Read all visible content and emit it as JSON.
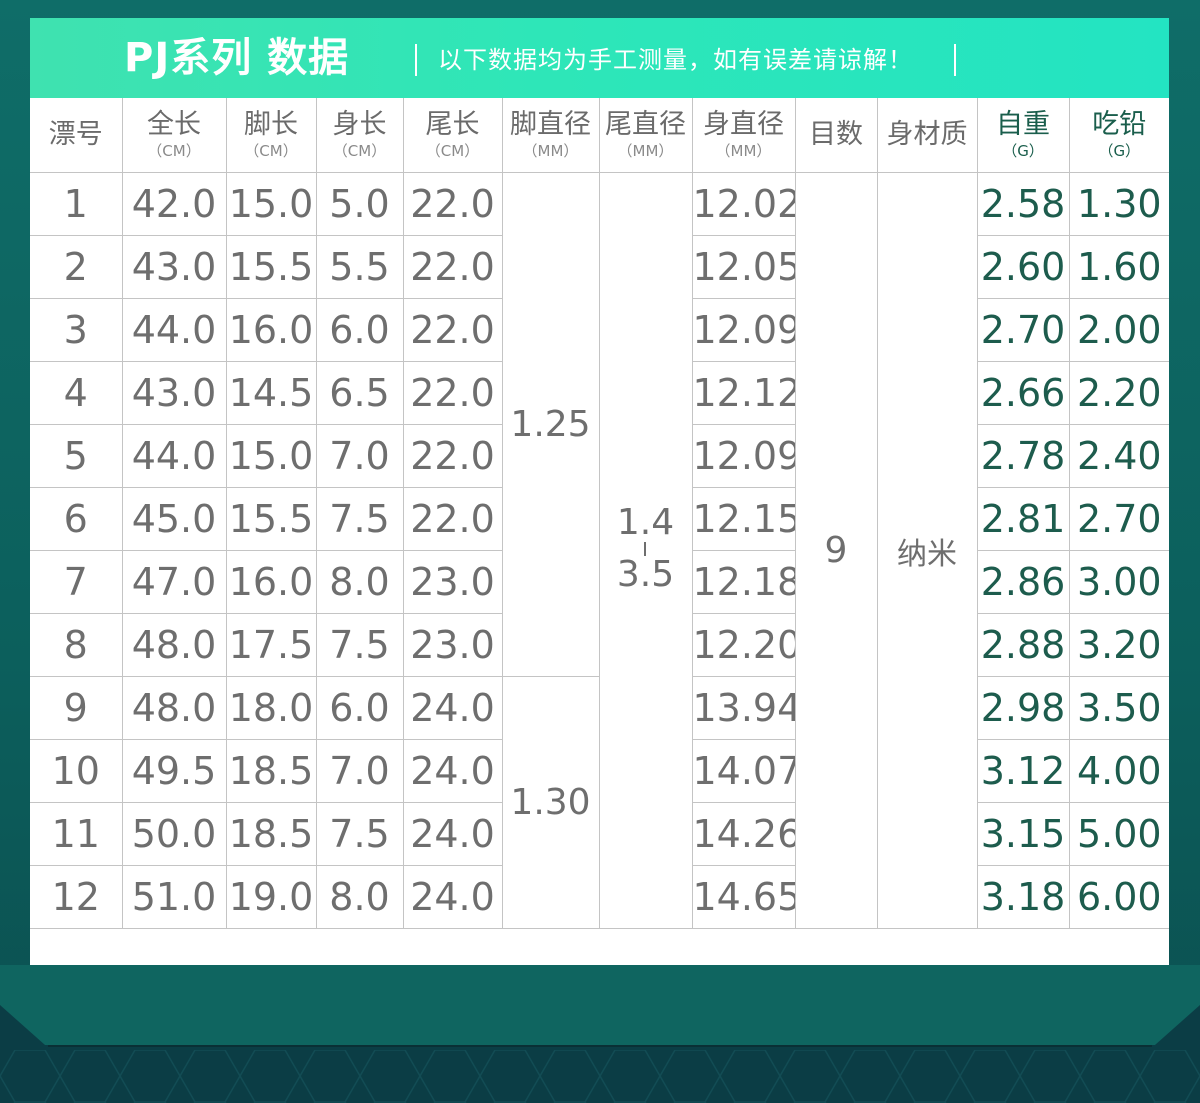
{
  "header": {
    "title": "PJ系列 数据",
    "note": "以下数据均为手工测量，如有误差请谅解！"
  },
  "columns": [
    {
      "label": "漂号",
      "unit": ""
    },
    {
      "label": "全长",
      "unit": "（CM）"
    },
    {
      "label": "脚长",
      "unit": "（CM）"
    },
    {
      "label": "身长",
      "unit": "（CM）"
    },
    {
      "label": "尾长",
      "unit": "（CM）"
    },
    {
      "label": "脚直径",
      "unit": "（MM）"
    },
    {
      "label": "尾直径",
      "unit": "（MM）"
    },
    {
      "label": "身直径",
      "unit": "（MM）"
    },
    {
      "label": "目数",
      "unit": ""
    },
    {
      "label": "身材质",
      "unit": ""
    },
    {
      "label": "自重",
      "unit": "（G）"
    },
    {
      "label": "吃铅",
      "unit": "（G）"
    }
  ],
  "rows": [
    [
      "1",
      "42.0",
      "15.0",
      "5.0",
      "22.0",
      "12.02",
      "2.58",
      "1.30"
    ],
    [
      "2",
      "43.0",
      "15.5",
      "5.5",
      "22.0",
      "12.05",
      "2.60",
      "1.60"
    ],
    [
      "3",
      "44.0",
      "16.0",
      "6.0",
      "22.0",
      "12.09",
      "2.70",
      "2.00"
    ],
    [
      "4",
      "43.0",
      "14.5",
      "6.5",
      "22.0",
      "12.12",
      "2.66",
      "2.20"
    ],
    [
      "5",
      "44.0",
      "15.0",
      "7.0",
      "22.0",
      "12.09",
      "2.78",
      "2.40"
    ],
    [
      "6",
      "45.0",
      "15.5",
      "7.5",
      "22.0",
      "12.15",
      "2.81",
      "2.70"
    ],
    [
      "7",
      "47.0",
      "16.0",
      "8.0",
      "23.0",
      "12.18",
      "2.86",
      "3.00"
    ],
    [
      "8",
      "48.0",
      "17.5",
      "7.5",
      "23.0",
      "12.20",
      "2.88",
      "3.20"
    ],
    [
      "9",
      "48.0",
      "18.0",
      "6.0",
      "24.0",
      "13.94",
      "2.98",
      "3.50"
    ],
    [
      "10",
      "49.5",
      "18.5",
      "7.0",
      "24.0",
      "14.07",
      "3.12",
      "4.00"
    ],
    [
      "11",
      "50.0",
      "18.5",
      "7.5",
      "24.0",
      "14.26",
      "3.15",
      "5.00"
    ],
    [
      "12",
      "51.0",
      "19.0",
      "8.0",
      "24.0",
      "14.65",
      "3.18",
      "6.00"
    ]
  ],
  "merged": {
    "foot_diameter_a": "1.25",
    "foot_diameter_b": "1.30",
    "tail_diameter_min": "1.4",
    "tail_diameter_max": "3.5",
    "mesh": "9",
    "material": "纳米"
  },
  "colors": {
    "header_gradient_start": "#3fe2b0",
    "header_gradient_end": "#23e4c2",
    "weight_text": "#1d5c4d",
    "body_text": "#6e6e6e",
    "background": "#0c5f5c"
  }
}
